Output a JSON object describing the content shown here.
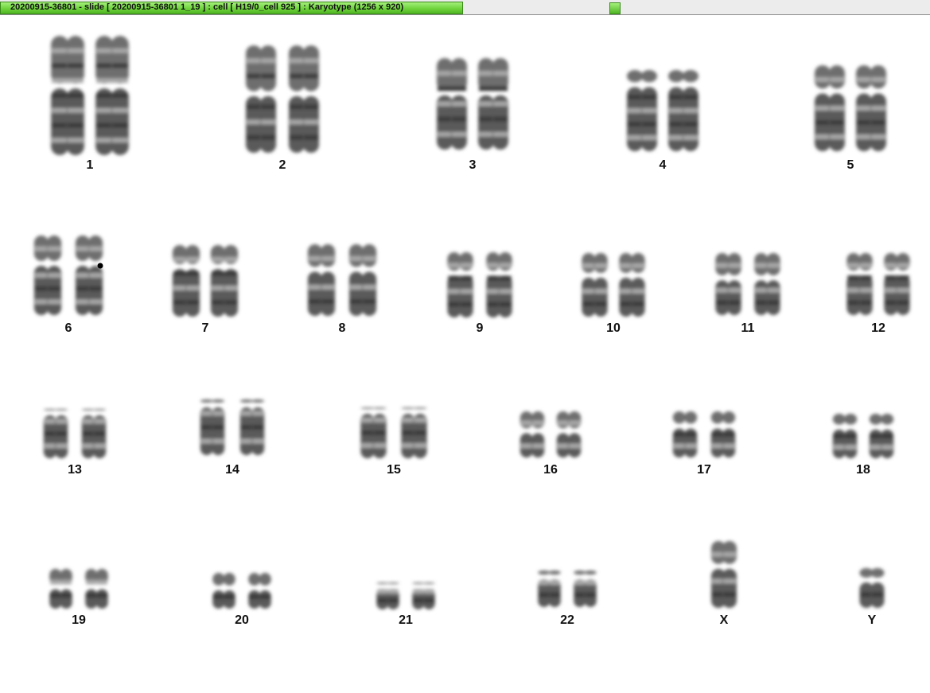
{
  "window": {
    "title": "20200915-36801 - slide [ 20200915-36801 1_19 ] : cell [ H19/0_cell 925 ] : Karyotype  (1256 x 920)"
  },
  "karyotype": {
    "chromosomes": [
      {
        "label": "1"
      },
      {
        "label": "2"
      },
      {
        "label": "3"
      },
      {
        "label": "4"
      },
      {
        "label": "5"
      },
      {
        "label": "6"
      },
      {
        "label": "7"
      },
      {
        "label": "8"
      },
      {
        "label": "9"
      },
      {
        "label": "10"
      },
      {
        "label": "11"
      },
      {
        "label": "12"
      },
      {
        "label": "13"
      },
      {
        "label": "14"
      },
      {
        "label": "15"
      },
      {
        "label": "16"
      },
      {
        "label": "17"
      },
      {
        "label": "18"
      },
      {
        "label": "19"
      },
      {
        "label": "20"
      },
      {
        "label": "21"
      },
      {
        "label": "22"
      },
      {
        "label": "X"
      },
      {
        "label": "Y"
      }
    ]
  }
}
